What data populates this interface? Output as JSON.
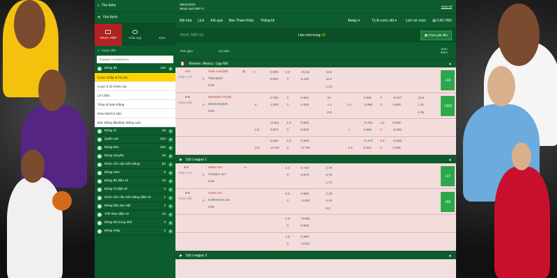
{
  "sidebar": {
    "search_label": "Tìm kiếm",
    "favorites_label": "Yêu thích",
    "tabs": [
      {
        "label": "TRỰC TIẾP",
        "active": true
      },
      {
        "label": "Hôm nay",
        "active": false
      },
      {
        "label": "Sớm",
        "active": false
      }
    ],
    "section_label": "Cược xiên",
    "search_placeholder": "Popular competitions",
    "sports": [
      {
        "name": "Bóng đá",
        "count": "120"
      },
      {
        "name": "Bóng rổ",
        "count": "45"
      },
      {
        "name": "Quần vợt",
        "count": "234"
      },
      {
        "name": "Bóng bàn",
        "count": "293"
      },
      {
        "name": "Bóng chuyền",
        "count": "45"
      },
      {
        "name": "Khúc côn cầu trên băng",
        "count": "50"
      },
      {
        "name": "Bóng ném",
        "count": "6"
      },
      {
        "name": "Bóng đá điện tử",
        "count": "32"
      },
      {
        "name": "Bóng rổ điện tử",
        "count": "3"
      },
      {
        "name": "Khúc côn cầu trên băng điện tử",
        "count": "1"
      },
      {
        "name": "Bóng bầu dục Mỹ",
        "count": "2"
      },
      {
        "name": "Thể thao điện tử",
        "count": "22"
      },
      {
        "name": "Bóng đá trong nhà",
        "count": "3"
      },
      {
        "name": "Bóng chày",
        "count": "3"
      }
    ],
    "submenu": [
      "Cược Chấp & Tài Xỉu",
      "Cược tỉ số chính xác",
      "Lẻ Chẵn",
      "Tổng số bàn thắng",
      "Nửa trận/Cả trận",
      "Bàn thắng đầu/Bàn thắng cuối"
    ]
  },
  "header": {
    "date": "06/01/2023",
    "time": "09:52 AM GMT+7",
    "view_all": "View All",
    "nav": [
      "Đội nhà",
      "Lịch",
      "Kết quả",
      "Bảo Tham Khảo",
      "Thống kê"
    ],
    "language": "Malay",
    "odds_type": "Tỷ lệ cược dội",
    "history": "Lịch sử cược",
    "balance": "0.00 VND"
  },
  "live": {
    "label": "TRỰC TIẾP (0)",
    "refresh_text": "Làm mới trong",
    "refresh_count": "10",
    "choose_button": "Chọn giải đấu"
  },
  "columns": {
    "time": "Thời gian",
    "event": "Sự kiện",
    "more": "Xem\nthêm"
  },
  "leagues": [
    {
      "name": "Women. Mexico. Liga MX"
    },
    {
      "name": "5x5 League 1"
    },
    {
      "name": "5x5 League 2"
    }
  ],
  "matches": {
    "m1": {
      "score": "1-1",
      "time": "Hiệp 2 10'",
      "home": "Club Leon(W)",
      "away": "Toluca(W)",
      "draw": "Hoà",
      "r1": [
        "0",
        "0.890",
        "0.5",
        "-0.211",
        "11.6"
      ],
      "r2": [
        "0.890",
        "0",
        "0.130",
        "11.6"
      ],
      "r3": [
        "1.13"
      ],
      "more": "+14"
    },
    "m2": {
      "score": "0-0",
      "time": "Chưa bắt...",
      "home": "Mazatlan FC(W)",
      "away": "Monterrey(W)",
      "draw": "Hoà",
      "r1": [
        "0.750",
        "0",
        "0.810",
        "22",
        "0.630",
        "0",
        "-0.917",
        "13.8"
      ],
      "r2": [
        "5",
        "1.000",
        "0",
        "0.930",
        "1.1",
        "1.5",
        "-0.885",
        "0",
        "0.660",
        "1.31"
      ],
      "r3": [
        "8.5",
        "4.05"
      ],
      "more": "+329"
    },
    "m2b": {
      "r1": [
        "-0.901",
        "4.5",
        "0.600",
        "-0.794",
        "1.5",
        "0.600"
      ],
      "r2": [
        "2.5",
        "0.670",
        "0",
        "0.630",
        "1",
        "0.560",
        "0",
        "-0.833"
      ]
    },
    "m2c": {
      "r1": [
        "0.520",
        "5.5",
        "0.560",
        "-0.476",
        "2.5",
        "-0.568"
      ],
      "r2": [
        "3.5",
        "-0.704",
        "0",
        "-0.746",
        "0.5",
        "0.310",
        "0",
        "0.390"
      ]
    },
    "m3": {
      "score": "3-3",
      "time": "Hiệp 2 21'",
      "home": "Mainz am.",
      "away": "Cologne am.",
      "draw": "Hoà",
      "r1": [
        "6.5",
        "0.740",
        "3.75"
      ],
      "r2": [
        "0",
        "0.970",
        "3.75"
      ],
      "r3": [
        "1.72"
      ],
      "more": "+17"
    },
    "m4": {
      "score": "0-0",
      "time": "Chưa bắt...",
      "home": "Union am.",
      "away": "Hoffenheim am.",
      "draw": "Hoà",
      "r1": [
        "5.5",
        "0.680",
        "2.15"
      ],
      "r2": [
        "0",
        "-0.952",
        "2.15"
      ],
      "r3": [
        "5.2"
      ],
      "more": "+50"
    },
    "m4b": {
      "r1": [
        "6.5",
        "-0.800"
      ],
      "r2": [
        "0",
        "0.550"
      ]
    },
    "m4c": {
      "r1": [
        "4.5",
        "0.290"
      ],
      "r2": [
        "0",
        "-0.541"
      ]
    }
  }
}
